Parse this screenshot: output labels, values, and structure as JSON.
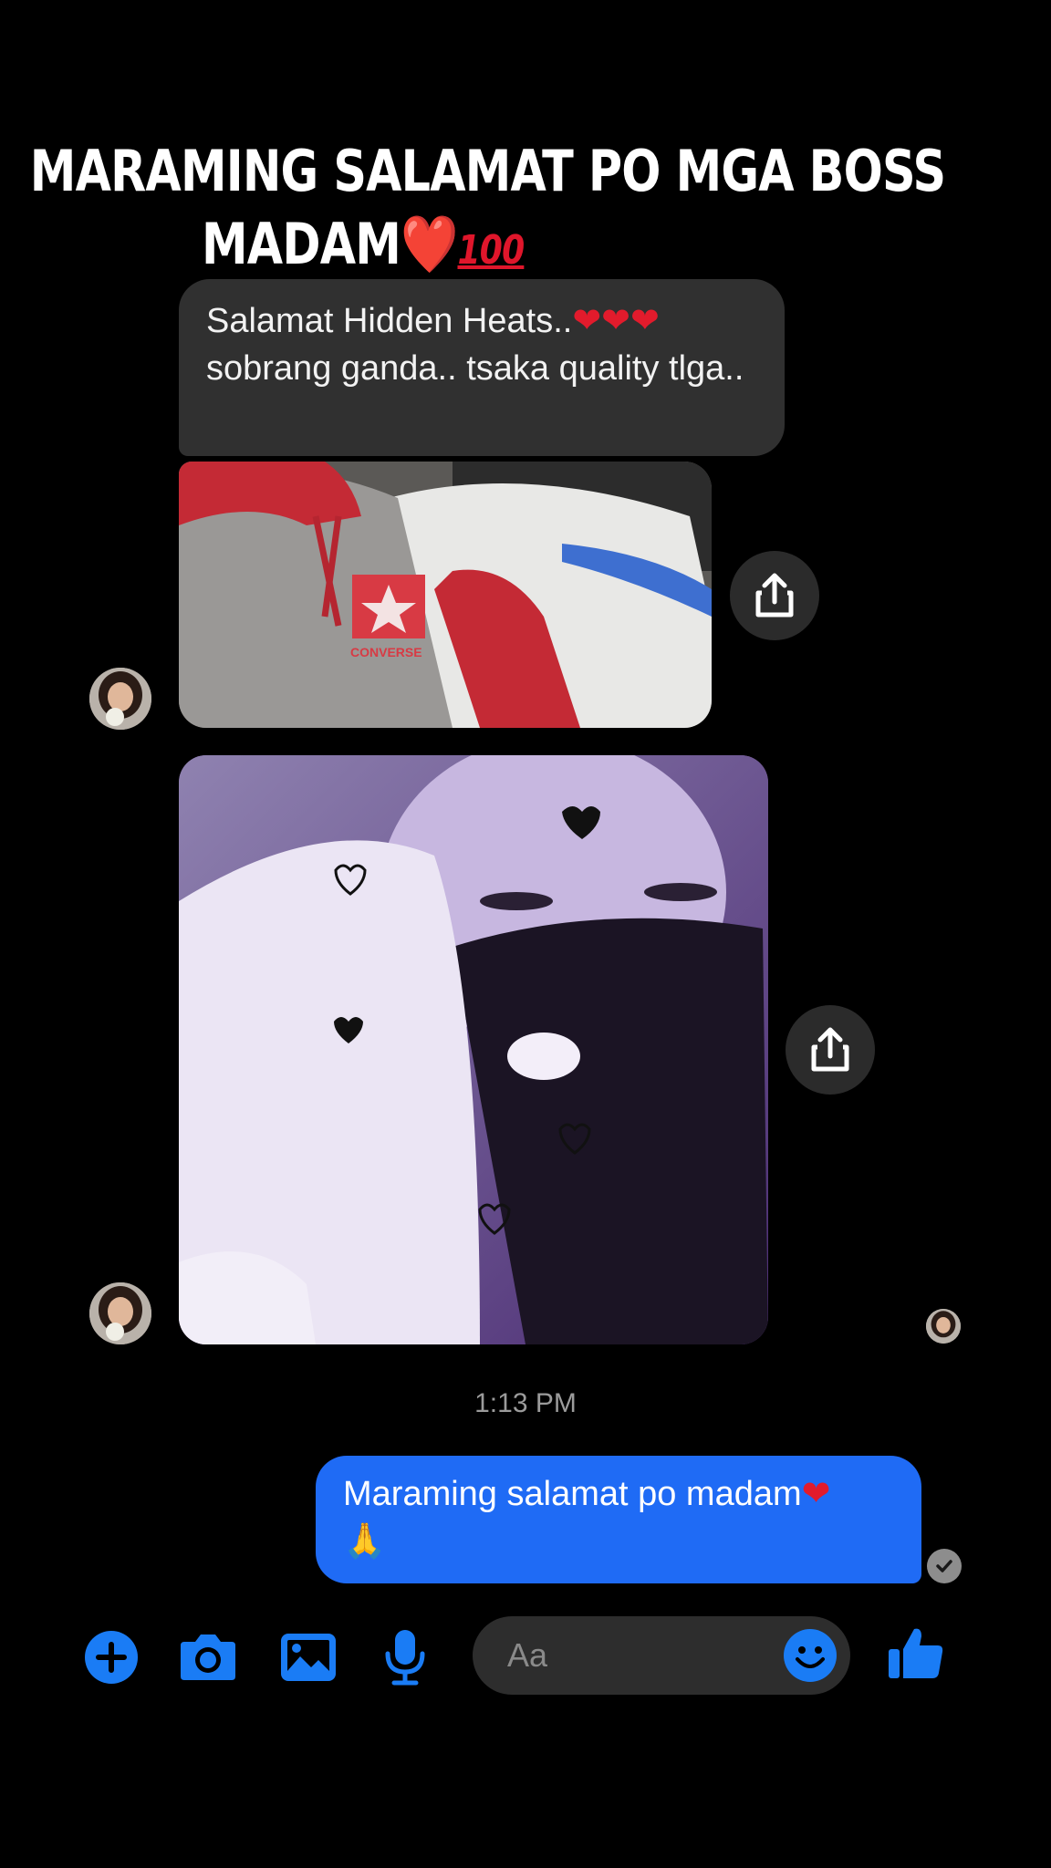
{
  "caption": {
    "line1": "MARAMING SALAMAT PO MGA BOSS",
    "line2": "MADAM",
    "heart": "❤️",
    "hundred": "100"
  },
  "messages": {
    "incoming": {
      "text_part1": "Salamat Hidden Heats..",
      "hearts": "❤❤❤",
      "text_part2": "sobrang ganda.. tsaka quality tlga.."
    },
    "photo1_brand": "CONVERSE",
    "timestamp": "1:13 PM",
    "outgoing": {
      "text": "Maraming salamat po madam",
      "heart": "❤",
      "emoji": "🙏"
    }
  },
  "composer": {
    "placeholder": "Aa",
    "icons": [
      "plus-icon",
      "camera-icon",
      "gallery-icon",
      "microphone-icon",
      "emoji-icon",
      "thumbs-up-icon"
    ]
  },
  "colors": {
    "accent": "#1f6bf5",
    "icon_blue": "#1a7cf5",
    "incoming_bubble": "#303030",
    "heart_red": "#e21b2c"
  }
}
